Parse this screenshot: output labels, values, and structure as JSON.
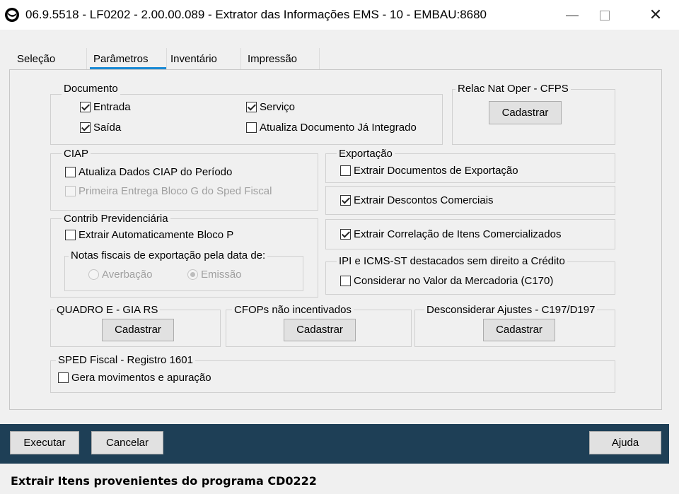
{
  "window": {
    "title": "06.9.5518 - LF0202 - 2.00.00.089 - Extrator das Informações EMS - 10 - EMBAU:8680",
    "minimize_glyph": "—",
    "close_glyph": "✕",
    "app_icon": "totvs-logo-icon"
  },
  "tabs": [
    {
      "label": "Seleção",
      "active": false
    },
    {
      "label": "Parâmetros",
      "active": true
    },
    {
      "label": "Inventário",
      "active": false
    },
    {
      "label": "Impressão",
      "active": false
    }
  ],
  "documento": {
    "label": "Documento",
    "entrada": {
      "label": "Entrada",
      "checked": true
    },
    "saida": {
      "label": "Saída",
      "checked": true
    },
    "servico": {
      "label": "Serviço",
      "checked": true
    },
    "atualiza": {
      "label": "Atualiza Documento Já Integrado",
      "checked": false
    }
  },
  "relac": {
    "label": "Relac Nat Oper - CFPS",
    "button": "Cadastrar"
  },
  "ciap": {
    "label": "CIAP",
    "atualiza": {
      "label": "Atualiza Dados CIAP do Período",
      "checked": false
    },
    "primeira": {
      "label": "Primeira Entrega Bloco G do Sped Fiscal",
      "checked": false,
      "enabled": false
    }
  },
  "exportacao": {
    "label": "Exportação",
    "extrair_docs": {
      "label": "Extrair Documentos de Exportação",
      "checked": false
    }
  },
  "descontos": {
    "label": "Extrair Descontos Comerciais",
    "checked": true
  },
  "correlacao": {
    "label": "Extrair Correlação de Itens Comercializados",
    "checked": true
  },
  "contrib": {
    "label": "Contrib Previdenciária",
    "extrair": {
      "label": "Extrair Automaticamente Bloco P",
      "checked": false
    },
    "notas_label": "Notas fiscais de exportação pela data de:",
    "averbacao": {
      "label": "Averbação",
      "selected": false
    },
    "emissao": {
      "label": "Emissão",
      "selected": true
    }
  },
  "ipi": {
    "label": "IPI e ICMS-ST destacados sem direito a Crédito",
    "considerar": {
      "label": "Considerar no Valor da Mercadoria (C170)",
      "checked": false
    }
  },
  "quadro": {
    "label": "QUADRO E - GIA RS",
    "button": "Cadastrar"
  },
  "cfops": {
    "label": "CFOPs não incentivados",
    "button": "Cadastrar"
  },
  "desconsiderar": {
    "label": "Desconsiderar Ajustes - C197/D197",
    "button": "Cadastrar"
  },
  "sped": {
    "label": "SPED Fiscal - Registro 1601",
    "gera": {
      "label": "Gera movimentos e apuração",
      "checked": false
    }
  },
  "actions": {
    "executar": "Executar",
    "cancelar": "Cancelar",
    "ajuda": "Ajuda"
  },
  "status": "Extrair Itens provenientes do programa CD0222",
  "colors": {
    "accent": "#1a8ad4",
    "bottom_bar": "#1e3f56"
  }
}
